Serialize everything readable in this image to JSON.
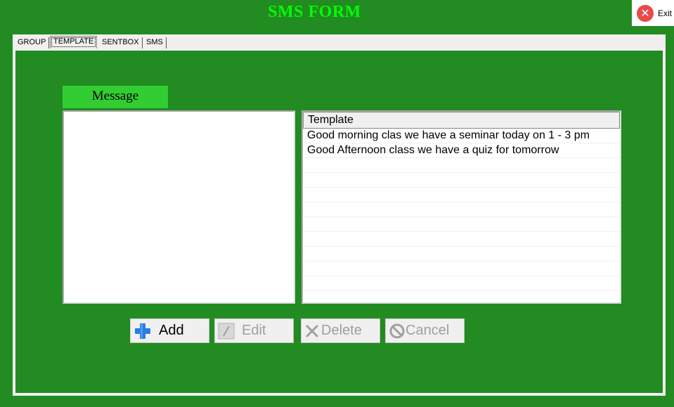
{
  "window": {
    "title": "SMS FORM"
  },
  "exit": {
    "label": "Exit"
  },
  "tabs": [
    {
      "label": "GROUP"
    },
    {
      "label": "TEMPLATE",
      "active": true
    },
    {
      "label": "SENTBOX"
    },
    {
      "label": "SMS"
    }
  ],
  "message": {
    "label": "Message",
    "value": ""
  },
  "templates": {
    "header": "Template",
    "rows": [
      "Good morning clas we have a seminar today on 1 - 3 pm",
      "Good Afternoon class we have a quiz for tomorrow"
    ]
  },
  "buttons": {
    "add": "Add",
    "edit": "Edit",
    "delete": "Delete",
    "cancel": "Cancel"
  },
  "colors": {
    "background": "#228b22",
    "title": "#00ff00",
    "message_label_bg": "#32cd32",
    "exit_icon": "#e84a4a"
  }
}
